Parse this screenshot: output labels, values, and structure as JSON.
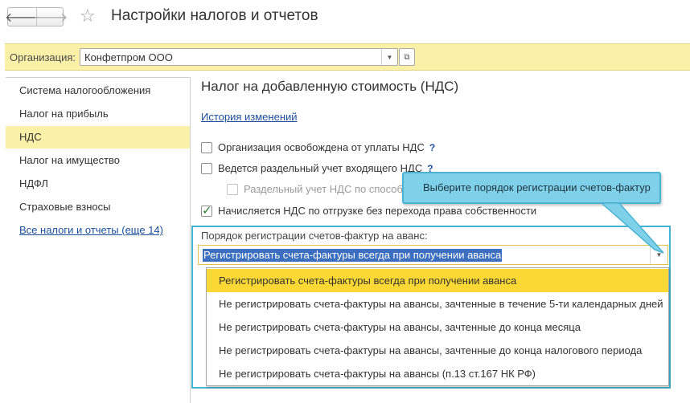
{
  "window": {
    "title": "Настройки налогов и отчетов",
    "back_glyph": "🡐",
    "forward_glyph": "🡒",
    "favorite_glyph": "☆"
  },
  "organization": {
    "label": "Организация:",
    "value": "Конфетпром ООО",
    "dropdown_glyph": "▼",
    "open_glyph": "⧉"
  },
  "sidebar": {
    "items": [
      {
        "label": "Система налогообложения"
      },
      {
        "label": "Налог на прибыль"
      },
      {
        "label": "НДС"
      },
      {
        "label": "Налог на имущество"
      },
      {
        "label": "НДФЛ"
      },
      {
        "label": "Страховые взносы"
      },
      {
        "label": "Все налоги и отчеты (еще 14)"
      }
    ],
    "active_index": 2
  },
  "main": {
    "title": "Налог на добавленную стоимость (НДС)",
    "history_link": "История изменений",
    "checkboxes": [
      {
        "label": "Организация освобождена от уплаты НДС",
        "help": "?",
        "checked": false
      },
      {
        "label": "Ведется раздельный учет входящего НДС",
        "help": "?",
        "checked": false
      },
      {
        "label": "Раздельный учет НДС по способ",
        "checked": false,
        "disabled": true
      },
      {
        "label": "Начисляется НДС по отгрузке без перехода права собственности",
        "checked": true
      }
    ],
    "invoice_order": {
      "label": "Порядок регистрации счетов-фактур на аванс:",
      "value": "Регистрировать счета-фактуры всегда при получении аванса",
      "dropdown_glyph": "▼",
      "options": [
        "Регистрировать счета-фактуры всегда при получении аванса",
        "Не регистрировать счета-фактуры на авансы, зачтенные в течение 5-ти календарных дней",
        "Не регистрировать счета-фактуры на авансы, зачтенные до конца месяца",
        "Не регистрировать счета-фактуры на авансы, зачтенные до конца налогового периода",
        "Не регистрировать счета-фактуры на авансы (п.13 ст.167 НК РФ)"
      ],
      "selected_index": 0
    }
  },
  "callout": {
    "text": "Выберите порядок регистрации счетов-фактур"
  },
  "colors": {
    "accent_yellow": "#fbf0a8",
    "selection_yellow": "#fbd833",
    "highlight_blue": "#43b3d2",
    "link": "#1b4f9c"
  }
}
